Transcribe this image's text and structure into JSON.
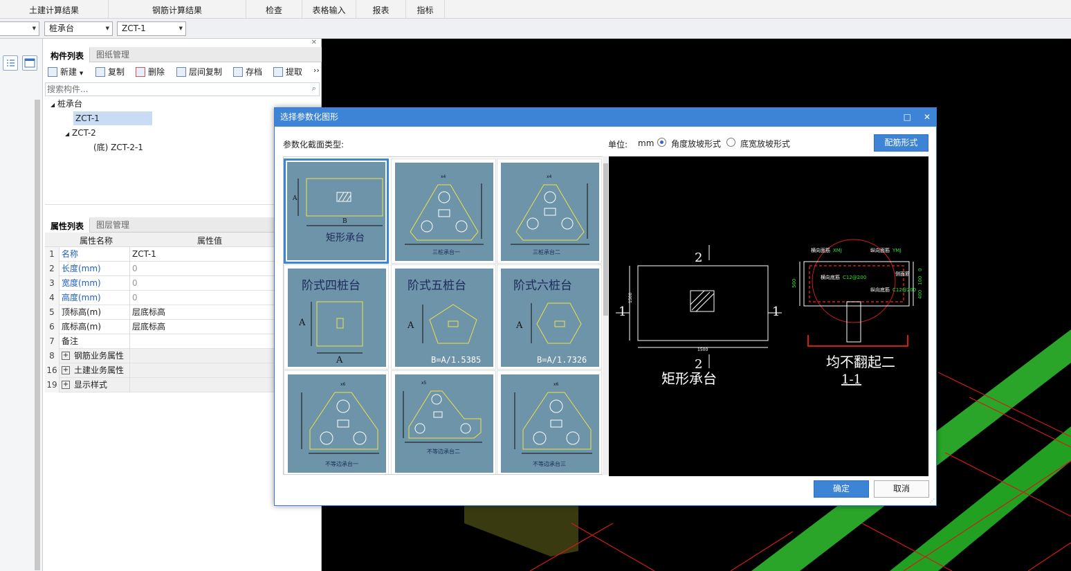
{
  "menu": {
    "tabs": [
      "土建计算结果",
      "钢筋计算结果",
      "检查",
      "表格输入",
      "报表",
      "指标"
    ]
  },
  "toolbar": {
    "combo1": "",
    "combo2": "桩承台",
    "combo3": "ZCT-1"
  },
  "component_panel": {
    "tabs": [
      "构件列表",
      "图纸管理"
    ],
    "buttons": [
      "新建",
      "复制",
      "删除",
      "层间复制",
      "存档",
      "提取"
    ],
    "more": "››",
    "search_placeholder": "搜索构件...",
    "tree": [
      {
        "label": "桩承台",
        "expander": "◢"
      },
      {
        "label": "ZCT-1"
      },
      {
        "label": "ZCT-2",
        "expander": "◢"
      },
      {
        "label": "(底)  ZCT-2-1"
      }
    ]
  },
  "property_panel": {
    "tabs": [
      "属性列表",
      "图层管理"
    ],
    "header": {
      "name": "属性名称",
      "value": "属性值"
    },
    "rows": [
      {
        "idx": "1",
        "name": "名称",
        "value": "ZCT-1"
      },
      {
        "idx": "2",
        "name": "长度(mm)",
        "value": "0"
      },
      {
        "idx": "3",
        "name": "宽度(mm)",
        "value": "0"
      },
      {
        "idx": "4",
        "name": "高度(mm)",
        "value": "0"
      },
      {
        "idx": "5",
        "name": "顶标高(m)",
        "value": "层底标高"
      },
      {
        "idx": "6",
        "name": "底标高(m)",
        "value": "层底标高"
      },
      {
        "idx": "7",
        "name": "备注",
        "value": ""
      },
      {
        "idx": "8",
        "name": "钢筋业务属性",
        "value": "",
        "expand": "+"
      },
      {
        "idx": "16",
        "name": "土建业务属性",
        "value": "",
        "expand": "+"
      },
      {
        "idx": "19",
        "name": "显示样式",
        "value": "",
        "expand": "+"
      }
    ]
  },
  "dialog": {
    "title": "选择参数化图形",
    "maximize": "□",
    "close": "✕",
    "section_label": "参数化截面类型:",
    "unit_label": "单位:",
    "unit": "mm",
    "radio1": "角度放坡形式",
    "radio2": "底宽放坡形式",
    "rebar_button": "配筋形式",
    "ok": "确定",
    "cancel": "取消",
    "shapes": [
      {
        "name": "矩形承台",
        "label_a": "A",
        "label_b": "B"
      },
      {
        "name": "三桩承台一",
        "dims": [
          "x4",
          "y3",
          "y2",
          "y1",
          "x1",
          "x2",
          "x3",
          "x2",
          "x1"
        ]
      },
      {
        "name": "三桩承台二",
        "dims": [
          "x4",
          "y3",
          "y2",
          "y1",
          "x1",
          "x2",
          "x3",
          "x2",
          "x1"
        ]
      },
      {
        "name": "阶式四桩台",
        "label_a": "A",
        "label_b": "A"
      },
      {
        "name": "阶式五桩台",
        "label_a": "A",
        "formula": "B=A/1.5385"
      },
      {
        "name": "阶式六桩台",
        "label_a": "A",
        "formula": "B=A/1.7326"
      },
      {
        "name": "不等边承台一",
        "dims": [
          "x6",
          "y4",
          "y3",
          "y2",
          "y1",
          "x1",
          "x2",
          "x3",
          "x2",
          "x1"
        ]
      },
      {
        "name": "不等边承台二",
        "dims": [
          "x5",
          "x4",
          "y4",
          "y3",
          "y2",
          "y1",
          "x1",
          "x2",
          "x3",
          "y5"
        ]
      },
      {
        "name": "不等边承台三",
        "dims": [
          "x6",
          "y4",
          "y3",
          "y2",
          "y1",
          "x1",
          "x2",
          "x3",
          "x4",
          "x5"
        ]
      }
    ],
    "preview": {
      "section_mark": "2",
      "side_mark": "1",
      "dim_width": "1500",
      "dim_height": "1500",
      "caption": "矩形承台",
      "detail_caption": "均不翻起二",
      "detail_title": "1-1",
      "label_top_left": "横向面筋",
      "label_top_right": "纵向面筋",
      "label_top_left_code": "XMJ",
      "label_top_right_code": "YMJ",
      "label_mid": "横向底筋",
      "label_mid_code": "C12@200",
      "label_low": "纵向底筋",
      "label_low_code": "C12@200",
      "label_side": "侧面筋",
      "dim_left": "500",
      "dim_right1": "0",
      "dim_right2": "100",
      "dim_right3": "400"
    }
  },
  "colors": {
    "accent": "#3d84d6",
    "card_bg": "#6d94a8",
    "shape_line": "#e8e84a",
    "cad_bg": "#000000"
  }
}
